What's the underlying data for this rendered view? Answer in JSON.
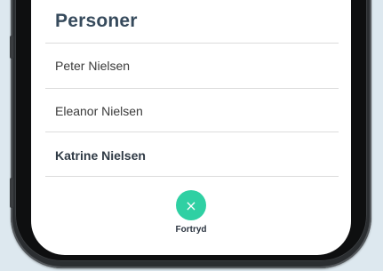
{
  "header": {
    "title": "Personer"
  },
  "people": [
    {
      "name": "Peter Nielsen",
      "selected": false
    },
    {
      "name": "Eleanor Nielsen",
      "selected": false
    },
    {
      "name": "Katrine Nielsen",
      "selected": true
    }
  ],
  "footer": {
    "cancel_icon": "close-icon",
    "cancel_glyph": "×",
    "cancel_label": "Fortryd"
  },
  "colors": {
    "accent": "#2fd0a3",
    "title": "#364a5c",
    "background": "#dde8ef"
  }
}
